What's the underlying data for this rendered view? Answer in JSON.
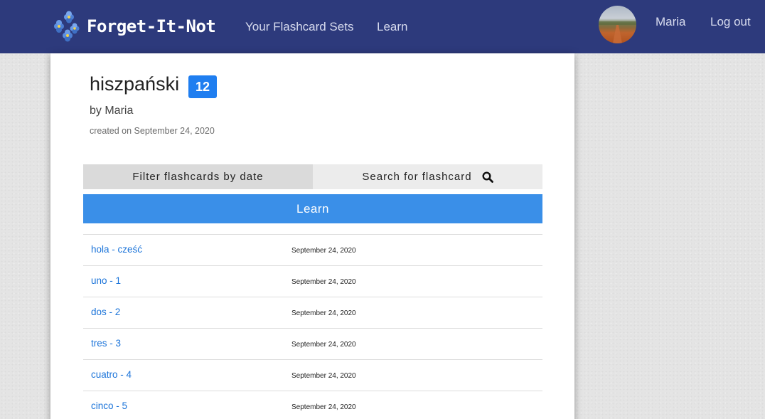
{
  "nav": {
    "brand": "Forget-It-Not",
    "links": [
      "Your Flashcard Sets",
      "Learn"
    ],
    "user": "Maria",
    "logout": "Log out"
  },
  "set": {
    "title": "hiszpański",
    "count": "12",
    "author": "by Maria",
    "created": "created on September 24, 2020"
  },
  "controls": {
    "filter_label": "Filter flashcards by date",
    "search_label": "Search for flashcard",
    "learn_label": "Learn"
  },
  "flashcards": [
    {
      "text": "hola - cześć",
      "date": "September 24, 2020"
    },
    {
      "text": "uno - 1",
      "date": "September 24, 2020"
    },
    {
      "text": "dos - 2",
      "date": "September 24, 2020"
    },
    {
      "text": "tres - 3",
      "date": "September 24, 2020"
    },
    {
      "text": "cuatro - 4",
      "date": "September 24, 2020"
    },
    {
      "text": "cinco - 5",
      "date": "September 24, 2020"
    }
  ],
  "colors": {
    "navbar": "#2d3a7c",
    "accent": "#3a8fe8",
    "badge": "#1f7ef0",
    "link": "#1a73d9"
  }
}
